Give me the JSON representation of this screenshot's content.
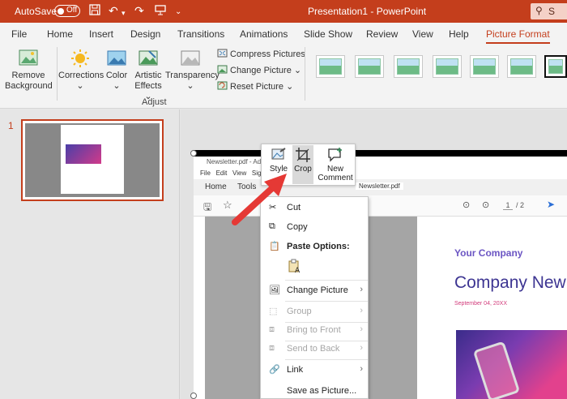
{
  "titlebar": {
    "autosave_label": "AutoSave",
    "autosave_state": "Off",
    "doc_title": "Presentation1 - PowerPoint",
    "search_text": "S"
  },
  "tabs": [
    "File",
    "Home",
    "Insert",
    "Design",
    "Transitions",
    "Animations",
    "Slide Show",
    "Review",
    "View",
    "Help",
    "Picture Format"
  ],
  "active_tab": "Picture Format",
  "ribbon": {
    "remove_background": [
      "Remove",
      "Background"
    ],
    "corrections": "Corrections",
    "color": "Color",
    "artistic_effects": [
      "Artistic",
      "Effects"
    ],
    "transparency": "Transparency",
    "compress": "Compress Pictures",
    "change_picture": "Change Picture",
    "reset_picture": "Reset Picture",
    "group_label": "Adjust"
  },
  "slide_panel": {
    "slide_number": "1"
  },
  "acrobat": {
    "title": "Newsletter.pdf - Ado",
    "menu": [
      "File",
      "Edit",
      "View",
      "Sign"
    ],
    "tabs": [
      "Home",
      "Tools"
    ],
    "doc_tab": "Newsletter.pdf",
    "page_current": "1",
    "page_total": "/ 2"
  },
  "page": {
    "company_small": "Your Company",
    "company_big": "Company New",
    "date": "September 04, 20XX"
  },
  "minibar": {
    "style": "Style",
    "crop": "Crop",
    "new_comment": [
      "New",
      "Comment"
    ]
  },
  "context_menu": {
    "cut": "Cut",
    "copy": "Copy",
    "paste_options": "Paste Options:",
    "change_picture": "Change Picture",
    "group": "Group",
    "bring_to_front": "Bring to Front",
    "send_to_back": "Send to Back",
    "link": "Link",
    "save_as_picture": "Save as Picture..."
  },
  "colors": {
    "accent": "#c43e1c",
    "arrow": "#e53935"
  }
}
